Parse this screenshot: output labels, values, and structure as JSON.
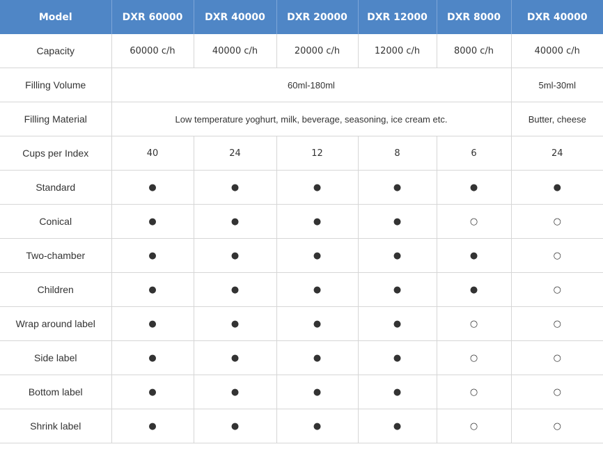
{
  "header": [
    "Model",
    "DXR 60000",
    "DXR 40000",
    "DXR 20000",
    "DXR 12000",
    "DXR 8000",
    "DXR 40000"
  ],
  "capacity": {
    "label": "Capacity",
    "values": [
      "60000 c/h",
      "40000 c/h",
      "20000 c/h",
      "12000 c/h",
      "8000 c/h",
      "40000 c/h"
    ]
  },
  "filling_volume": {
    "label": "Filling Volume",
    "main": "60ml-180ml",
    "last": "5ml-30ml"
  },
  "filling_material": {
    "label": "Filling Material",
    "main": "Low temperature yoghurt, milk, beverage, seasoning, ice cream etc.",
    "last": "Butter, cheese"
  },
  "cups_per_index": {
    "label": "Cups per Index",
    "values": [
      "40",
      "24",
      "12",
      "8",
      "6",
      "24"
    ]
  },
  "symbol_rows": [
    {
      "label": "Standard",
      "values": [
        "●",
        "●",
        "●",
        "●",
        "●",
        "●"
      ]
    },
    {
      "label": "Conical",
      "values": [
        "●",
        "●",
        "●",
        "●",
        "○",
        "○"
      ]
    },
    {
      "label": "Two-chamber",
      "values": [
        "●",
        "●",
        "●",
        "●",
        "●",
        "○"
      ]
    },
    {
      "label": "Children",
      "values": [
        "●",
        "●",
        "●",
        "●",
        "●",
        "○"
      ]
    },
    {
      "label": "Wrap around label",
      "values": [
        "●",
        "●",
        "●",
        "●",
        "○",
        "○"
      ]
    },
    {
      "label": "Side label",
      "values": [
        "●",
        "●",
        "●",
        "●",
        "○",
        "○"
      ]
    },
    {
      "label": "Bottom label",
      "values": [
        "●",
        "●",
        "●",
        "●",
        "○",
        "○"
      ]
    },
    {
      "label": "Shrink label",
      "values": [
        "●",
        "●",
        "●",
        "●",
        "○",
        "○"
      ]
    }
  ]
}
